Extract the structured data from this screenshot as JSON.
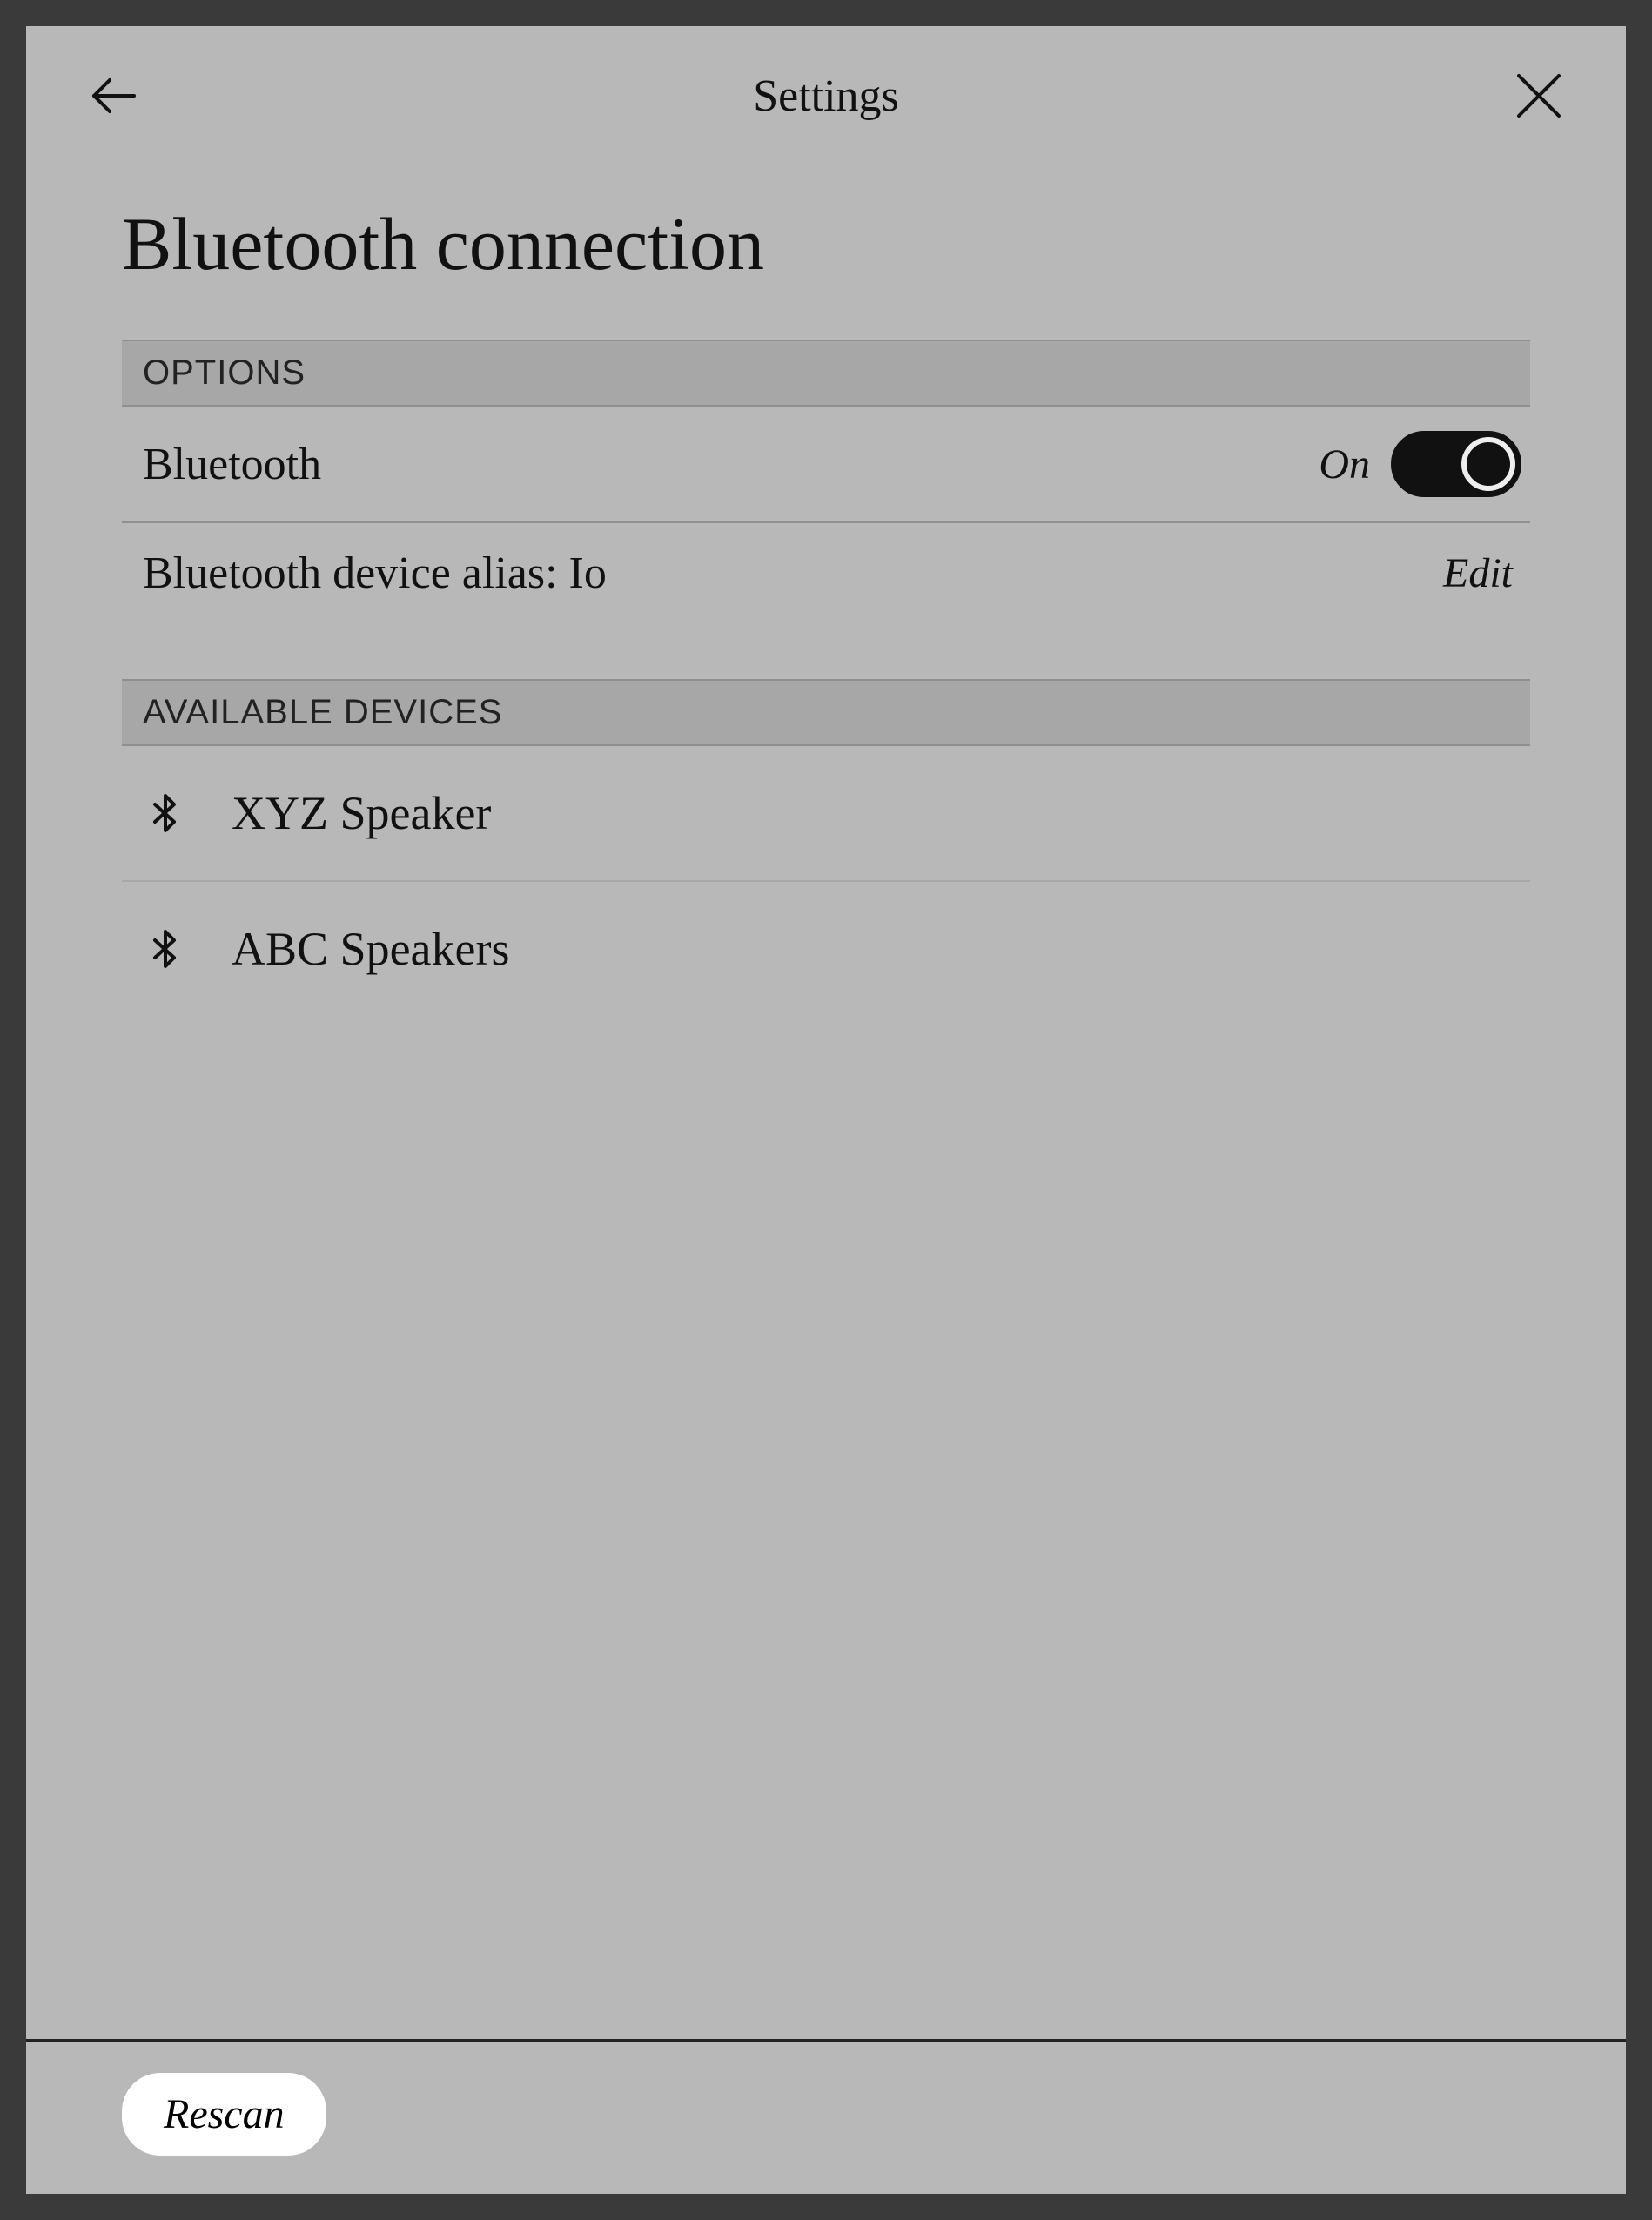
{
  "header": {
    "title": "Settings"
  },
  "page": {
    "title": "Bluetooth connection"
  },
  "sections": {
    "options_label": "OPTIONS",
    "available_label": "AVAILABLE DEVICES"
  },
  "bluetooth": {
    "label": "Bluetooth",
    "state": "On",
    "enabled": true
  },
  "alias": {
    "prefix": "Bluetooth device alias: ",
    "value": "Io",
    "edit_label": "Edit"
  },
  "devices": [
    {
      "name": "XYZ Speaker"
    },
    {
      "name": "ABC Speakers"
    }
  ],
  "footer": {
    "rescan_label": "Rescan"
  }
}
